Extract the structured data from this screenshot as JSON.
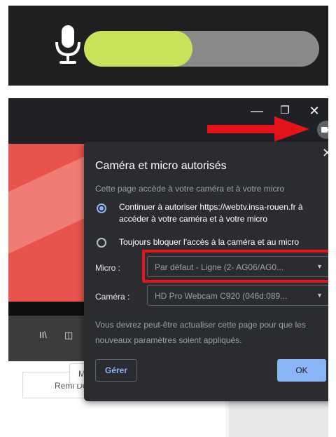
{
  "mic_meter": {
    "level": 0.46,
    "fill_color": "#c8e25a",
    "track_color": "#8a8a8a",
    "icon": "microphone-icon"
  },
  "window_controls": {
    "minimize": "—",
    "restore": "❐",
    "close": "✕"
  },
  "camera_indicator": {
    "icon": "video-camera-icon"
  },
  "arrow": {
    "color": "#e5141b"
  },
  "background_page": {
    "controls": [
      "II\\",
      "◫"
    ],
    "user_label": "Remi De",
    "edit_button": "Modifier cette page"
  },
  "dialog": {
    "close": "✕",
    "title": "Caméra et micro autorisés",
    "subtitle": "Cette page accède à votre caméra et à votre micro",
    "option_allow": "Continuer à autoriser https://webtv.insa-rouen.fr à accéder à votre caméra et à votre micro",
    "option_block": "Toujours bloquer l'accès à la caméra et au micro",
    "micro_label": "Micro :",
    "micro_value": "Par défaut - Ligne (2- AG06/AG0...",
    "camera_label": "Caméra :",
    "camera_value": "HD Pro Webcam C920 (046d:089...",
    "notice": "Vous devrez peut-être actualiser cette page pour que les nouveaux paramètres soient appliqués.",
    "manage_button": "Gérer",
    "ok_button": "OK",
    "highlight_color": "#e5141b",
    "accent_color": "#8ab4f8"
  }
}
